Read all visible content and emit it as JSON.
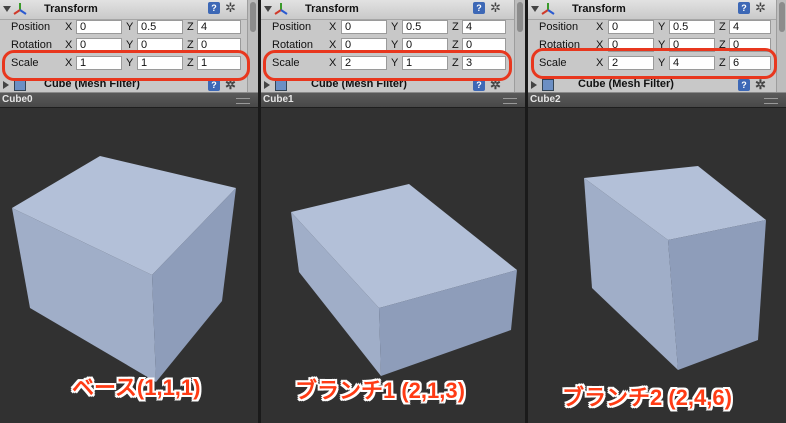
{
  "panels": [
    {
      "header_title": "Transform",
      "position": {
        "label": "Position",
        "x": "0",
        "y": "0.5",
        "z": "4"
      },
      "rotation": {
        "label": "Rotation",
        "x": "0",
        "y": "0",
        "z": "0"
      },
      "scale": {
        "label": "Scale",
        "x": "1",
        "y": "1",
        "z": "1"
      },
      "mesh_filter": "Cube (Mesh Filter)",
      "camera_label": "Cube0",
      "caption": "ベース(1,1,1)"
    },
    {
      "header_title": "Transform",
      "position": {
        "label": "Position",
        "x": "0",
        "y": "0.5",
        "z": "4"
      },
      "rotation": {
        "label": "Rotation",
        "x": "0",
        "y": "0",
        "z": "0"
      },
      "scale": {
        "label": "Scale",
        "x": "2",
        "y": "1",
        "z": "3"
      },
      "mesh_filter": "Cube (Mesh Filter)",
      "camera_label": "Cube1",
      "caption": "ブランチ1 (2,1,3)"
    },
    {
      "header_title": "Transform",
      "position": {
        "label": "Position",
        "x": "0",
        "y": "0.5",
        "z": "4"
      },
      "rotation": {
        "label": "Rotation",
        "x": "0",
        "y": "0",
        "z": "0"
      },
      "scale": {
        "label": "Scale",
        "x": "2",
        "y": "4",
        "z": "6"
      },
      "mesh_filter": "Cube (Mesh Filter)",
      "camera_label": "Cube2",
      "caption": "ブランチ2 (2,4,6)"
    }
  ],
  "axes": {
    "x": "X",
    "y": "Y",
    "z": "Z"
  },
  "help_glyph": "?",
  "gear_glyph": "✲",
  "icons": [
    "transform-icon",
    "help-icon",
    "gear-icon",
    "mesh-filter-icon"
  ],
  "colors": {
    "highlight_ring": "#e8371e",
    "caption": "#ff3b14",
    "cube_face": "#a9b7d1"
  }
}
